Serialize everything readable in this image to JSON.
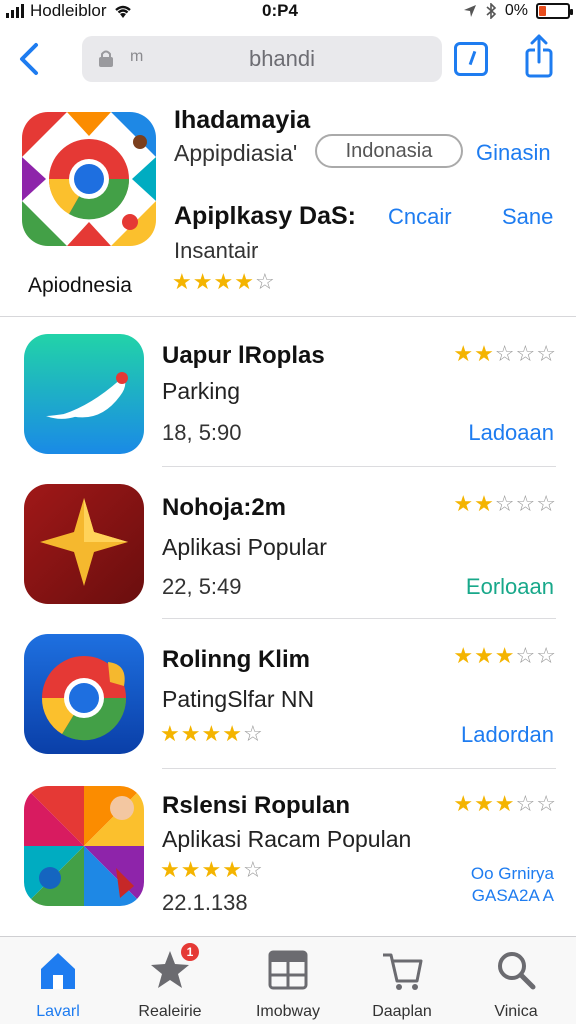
{
  "status_bar": {
    "carrier": "Hodleiblor",
    "time": "0:P4",
    "battery": "0%",
    "battery_level": 0.25
  },
  "nav": {
    "search_hint": "m",
    "search_value": "bhandi",
    "back_icon": "chevron-left-icon",
    "tabs_icon": "tabs-icon",
    "share_icon": "share-icon"
  },
  "featured": {
    "title": "Ihadamayia",
    "subtitle": "Appipdiasia'",
    "pill": "Indonasia",
    "link1": "Ginasin",
    "name": "Apiplkasy DaS:",
    "link2": "Cncair",
    "link3": "Sane",
    "description": "Insantair",
    "caption": "Apiodnesia",
    "rating": 4
  },
  "apps": [
    {
      "title": "Uapur lRoplas",
      "subtitle": "Parking",
      "meta": "18, 5:90",
      "action": "Ladoaan",
      "action_color": "blue",
      "rating": 2,
      "rating_pos": "right"
    },
    {
      "title": "Nohoja:2m",
      "subtitle": "Aplikasi Popular",
      "meta": "22, 5:49",
      "action": "Eorloaan",
      "action_color": "green",
      "rating": 2,
      "rating_pos": "right"
    },
    {
      "title": "Rolinng Klim",
      "subtitle": "PatingSlfar NN",
      "meta": "",
      "action": "Ladordan",
      "action_color": "blue",
      "rating": 3,
      "rating_pos": "right",
      "rating_inline": 4
    },
    {
      "title": "Rslensi Ropulan",
      "subtitle": "Aplikasi Racam Populan",
      "meta": "22.1.138",
      "action": "Oo Grnirya",
      "action2": "GASA2A A",
      "action_color": "blue",
      "rating": 3,
      "rating_pos": "right",
      "rating_inline": 4
    }
  ],
  "tab_bar": [
    {
      "label": "Lavarl",
      "icon": "home-icon",
      "active": true
    },
    {
      "label": "Realeirie",
      "icon": "star-icon",
      "active": false,
      "badge": "1"
    },
    {
      "label": "Imobway",
      "icon": "grid-icon",
      "active": false
    },
    {
      "label": "Daaplan",
      "icon": "cart-icon",
      "active": false
    },
    {
      "label": "Vinica",
      "icon": "search-icon",
      "active": false
    }
  ]
}
